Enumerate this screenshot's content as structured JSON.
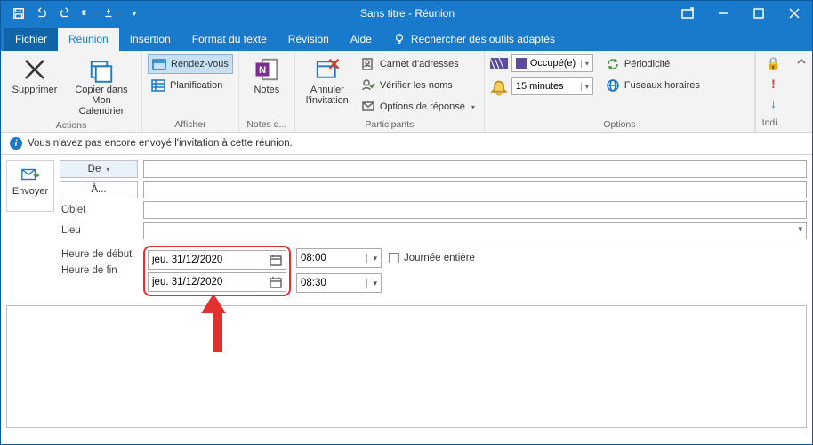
{
  "title": "Sans titre  -  Réunion",
  "tabs": {
    "file": "Fichier",
    "meeting": "Réunion",
    "insert": "Insertion",
    "format": "Format du texte",
    "review": "Révision",
    "help": "Aide",
    "tellme": "Rechercher des outils adaptés"
  },
  "ribbon": {
    "actions": {
      "delete": "Supprimer",
      "copy": "Copier dans Mon Calendrier",
      "label": "Actions"
    },
    "show": {
      "appt": "Rendez-vous",
      "sched": "Planification",
      "label": "Afficher"
    },
    "notes": {
      "btn": "Notes",
      "label": "Notes d..."
    },
    "participants": {
      "cancel": "Annuler l'invitation",
      "ab": "Carnet d'adresses",
      "check": "Vérifier les noms",
      "resp": "Options de réponse",
      "label": "Participants"
    },
    "options": {
      "busy": "Occupé(e)",
      "recur": "Périodicité",
      "reminder": "15 minutes",
      "tz": "Fuseaux horaires",
      "label": "Options"
    },
    "indi": "Indi..."
  },
  "info": "Vous n'avez pas encore envoyé l'invitation à cette réunion.",
  "form": {
    "send": "Envoyer",
    "from": "De",
    "to": "À...",
    "subject": "Objet",
    "location": "Lieu",
    "start": "Heure de début",
    "end": "Heure de fin",
    "startDate": "jeu. 31/12/2020",
    "endDate": "jeu. 31/12/2020",
    "startTime": "08:00",
    "endTime": "08:30",
    "allday": "Journée entière"
  }
}
